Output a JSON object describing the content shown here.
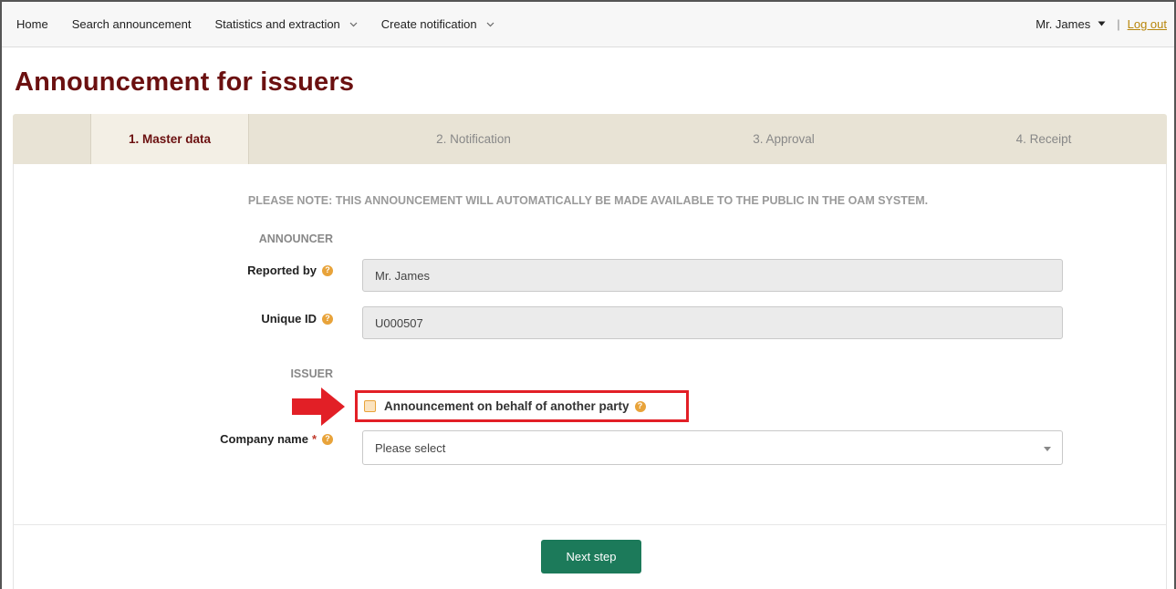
{
  "nav": {
    "items": [
      {
        "label": "Home",
        "dropdown": false
      },
      {
        "label": "Search announcement",
        "dropdown": false
      },
      {
        "label": "Statistics and extraction",
        "dropdown": true
      },
      {
        "label": "Create notification",
        "dropdown": true
      }
    ],
    "user_name": "Mr. James",
    "separator": "|",
    "logout_label": "Log out"
  },
  "page": {
    "title": "Announcement for issuers"
  },
  "wizard": {
    "steps": [
      {
        "label": "1. Master data",
        "active": true
      },
      {
        "label": "2. Notification",
        "active": false
      },
      {
        "label": "3. Approval",
        "active": false
      },
      {
        "label": "4. Receipt",
        "active": false
      }
    ]
  },
  "form": {
    "notice": "PLEASE NOTE: THIS ANNOUNCEMENT WILL AUTOMATICALLY BE MADE AVAILABLE TO THE PUBLIC IN THE OAM SYSTEM.",
    "announcer_section": "ANNOUNCER",
    "reported_by_label": "Reported by",
    "reported_by_value": "Mr. James",
    "unique_id_label": "Unique ID",
    "unique_id_value": "U000507",
    "issuer_section": "ISSUER",
    "behalf_checkbox_label": "Announcement on behalf of another party",
    "behalf_checked": false,
    "company_name_label": "Company name",
    "company_required_mark": "*",
    "company_select_value": "Please select",
    "next_button_label": "Next step"
  },
  "colors": {
    "title": "#6b1010",
    "accent_button": "#1c7a5a",
    "help_icon": "#e8a33a",
    "highlight_box": "#e21f26",
    "wizard_bg": "#e8e3d5"
  },
  "icons": {
    "help": "question-circle-icon",
    "dropdown": "chevron-down-icon",
    "annotation": "red-arrow-icon"
  }
}
